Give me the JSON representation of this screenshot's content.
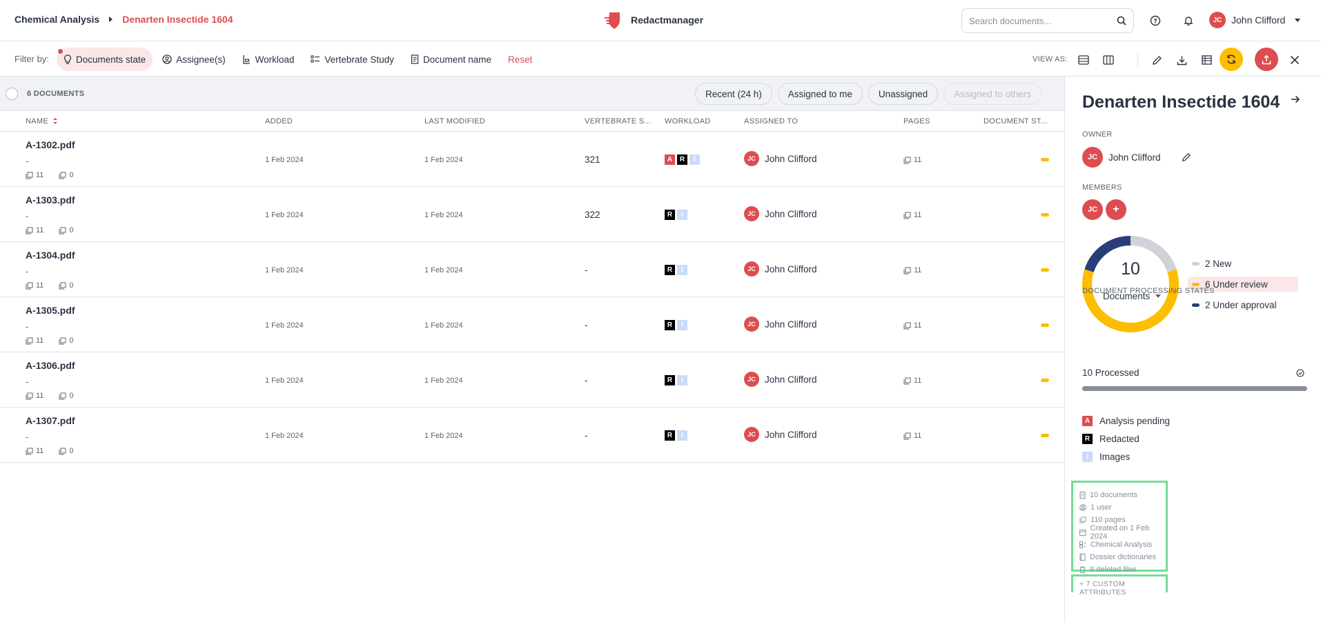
{
  "breadcrumb": {
    "parent": "Chemical Analysis",
    "current": "Denarten Insectide 1604"
  },
  "brand": {
    "name": "Redactmanager"
  },
  "search": {
    "placeholder": "Search documents..."
  },
  "user": {
    "initials": "JC",
    "name": "John Clifford"
  },
  "filterbar": {
    "label": "Filter by:",
    "filters": [
      "Documents state",
      "Assignee(s)",
      "Workload",
      "Vertebrate Study",
      "Document name"
    ],
    "reset": "Reset",
    "view_as": "VIEW AS:"
  },
  "list": {
    "count_label": "6 DOCUMENTS",
    "quick_filters": [
      "Recent (24 h)",
      "Assigned to me",
      "Unassigned",
      "Assigned to others"
    ],
    "columns": [
      "NAME",
      "ADDED",
      "LAST MODIFIED",
      "VERTEBRATE S...",
      "WORKLOAD",
      "ASSIGNED TO",
      "PAGES",
      "DOCUMENT ST..."
    ],
    "rows": [
      {
        "name": "A-1302.pdf",
        "desc": "-",
        "pages_meta": "11",
        "comments": "0",
        "added": "1 Feb 2024",
        "modified": "1 Feb 2024",
        "vertebrate": "321",
        "assignee": "John Clifford",
        "initials": "JC",
        "pages": "11"
      },
      {
        "name": "A-1303.pdf",
        "desc": "-",
        "pages_meta": "11",
        "comments": "0",
        "added": "1 Feb 2024",
        "modified": "1 Feb 2024",
        "vertebrate": "322",
        "assignee": "John Clifford",
        "initials": "JC",
        "pages": "11"
      },
      {
        "name": "A-1304.pdf",
        "desc": "-",
        "pages_meta": "11",
        "comments": "0",
        "added": "1 Feb 2024",
        "modified": "1 Feb 2024",
        "vertebrate": "-",
        "assignee": "John Clifford",
        "initials": "JC",
        "pages": "11"
      },
      {
        "name": "A-1305.pdf",
        "desc": "-",
        "pages_meta": "11",
        "comments": "0",
        "added": "1 Feb 2024",
        "modified": "1 Feb 2024",
        "vertebrate": "-",
        "assignee": "John Clifford",
        "initials": "JC",
        "pages": "11"
      },
      {
        "name": "A-1306.pdf",
        "desc": "-",
        "pages_meta": "11",
        "comments": "0",
        "added": "1 Feb 2024",
        "modified": "1 Feb 2024",
        "vertebrate": "-",
        "assignee": "John Clifford",
        "initials": "JC",
        "pages": "11"
      },
      {
        "name": "A-1307.pdf",
        "desc": "-",
        "pages_meta": "11",
        "comments": "0",
        "added": "1 Feb 2024",
        "modified": "1 Feb 2024",
        "vertebrate": "-",
        "assignee": "John Clifford",
        "initials": "JC",
        "pages": "11"
      }
    ],
    "workload_badges": {
      "a": "A",
      "r": "R",
      "i": "I"
    }
  },
  "panel": {
    "title": "Denarten Insectide 1604",
    "owner_label": "OWNER",
    "owner_name": "John Clifford",
    "owner_initials": "JC",
    "members_label": "MEMBERS",
    "member_initials": "JC",
    "add_member": "+",
    "donut_value": "10",
    "donut_label": "Documents",
    "legend": [
      {
        "label": "2 New",
        "color": "#cfd2d8"
      },
      {
        "label": "6 Under review",
        "color": "#fdbd00"
      },
      {
        "label": "2 Under approval",
        "color": "#283e77"
      }
    ],
    "processing_label": "DOCUMENT PROCESSING STATES",
    "processing_text": "10 Processed",
    "workload_legend": [
      {
        "badge": "A",
        "label": "Analysis pending"
      },
      {
        "badge": "R",
        "label": "Redacted"
      },
      {
        "badge": "I",
        "label": "Images"
      }
    ],
    "stats": [
      "10 documents",
      "1 user",
      "110 pages",
      "Created on 1 Feb 2024",
      "Chemical Analysis",
      "Dossier dictionaries",
      "9 deleted files"
    ],
    "custom_attributes": "+ 7 CUSTOM ATTRIBUTES"
  },
  "colors": {
    "accent": "#dd4d50",
    "review": "#fdbd00",
    "approval": "#283e77",
    "new": "#cfd2d8",
    "highlight_box": "#74dc95"
  }
}
